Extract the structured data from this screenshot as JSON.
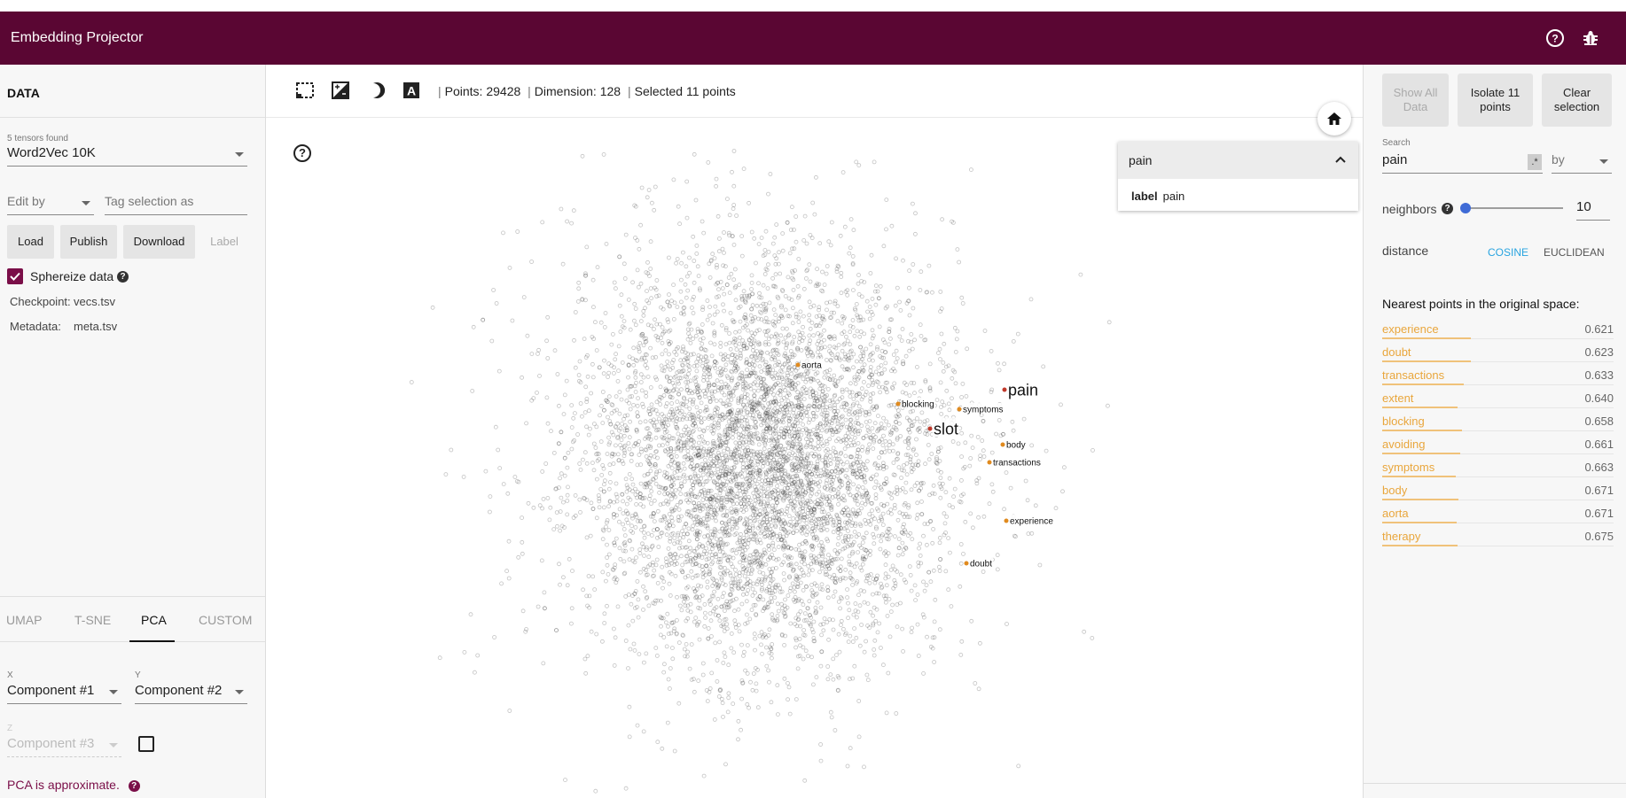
{
  "app": {
    "title": "Embedding Projector",
    "help_icon": "help-circle-icon",
    "bug_icon": "bug-icon",
    "bar_color": "#5a0633"
  },
  "left": {
    "header": "DATA",
    "tensors_found": "5 tensors found",
    "tensor_selected": "Word2Vec 10K",
    "edit_by": "Edit by",
    "tag_placeholder": "Tag selection as",
    "buttons": {
      "load": "Load",
      "publish": "Publish",
      "download": "Download",
      "label": "Label"
    },
    "sphereize": "Sphereize data",
    "checkpoint_label": "Checkpoint:",
    "checkpoint_value": "vecs.tsv",
    "metadata_label": "Metadata:",
    "metadata_value": "meta.tsv",
    "tabs": [
      "UMAP",
      "T-SNE",
      "PCA",
      "CUSTOM"
    ],
    "active_tab": "PCA",
    "x_label": "X",
    "x_value": "Component #1",
    "y_label": "Y",
    "y_value": "Component #2",
    "z_label": "Z",
    "z_value": "Component #3",
    "pca_note": "PCA is approximate.",
    "accent_color": "#7a0e48"
  },
  "center": {
    "stats": {
      "points": "Points: 29428",
      "dimension": "Dimension: 128",
      "selected": "Selected 11 points"
    },
    "search_card": {
      "query": "pain",
      "row_key": "label",
      "row_value": "pain"
    },
    "point_labels": [
      {
        "text": "aorta",
        "size": "small"
      },
      {
        "text": "pain",
        "size": "large"
      },
      {
        "text": "blocking",
        "size": "small"
      },
      {
        "text": "symptoms",
        "size": "small"
      },
      {
        "text": "slot",
        "size": "large"
      },
      {
        "text": "body",
        "size": "small"
      },
      {
        "text": "transactions",
        "size": "small"
      },
      {
        "text": "experience",
        "size": "small"
      },
      {
        "text": "doubt",
        "size": "small"
      }
    ],
    "total_points": 29428
  },
  "right": {
    "buttons": {
      "show_all": "Show All Data",
      "isolate": "Isolate 11 points",
      "clear": "Clear selection"
    },
    "search_label": "Search",
    "search_value": "pain",
    "regex_label": ".*",
    "by_label": "by",
    "neighbors_label": "neighbors",
    "neighbors_value": "10",
    "distance_label": "distance",
    "distance_options": [
      "COSINE",
      "EUCLIDEAN"
    ],
    "distance_active": "COSINE",
    "active_color": "#29a4e0",
    "nearest_title": "Nearest points in the original space:",
    "nearest": [
      {
        "name": "experience",
        "value": "0.621"
      },
      {
        "name": "doubt",
        "value": "0.623"
      },
      {
        "name": "transactions",
        "value": "0.633"
      },
      {
        "name": "extent",
        "value": "0.640"
      },
      {
        "name": "blocking",
        "value": "0.658"
      },
      {
        "name": "avoiding",
        "value": "0.661"
      },
      {
        "name": "symptoms",
        "value": "0.663"
      },
      {
        "name": "body",
        "value": "0.671"
      },
      {
        "name": "aorta",
        "value": "0.671"
      },
      {
        "name": "therapy",
        "value": "0.675"
      }
    ],
    "nearest_color": "#e9a63c"
  }
}
